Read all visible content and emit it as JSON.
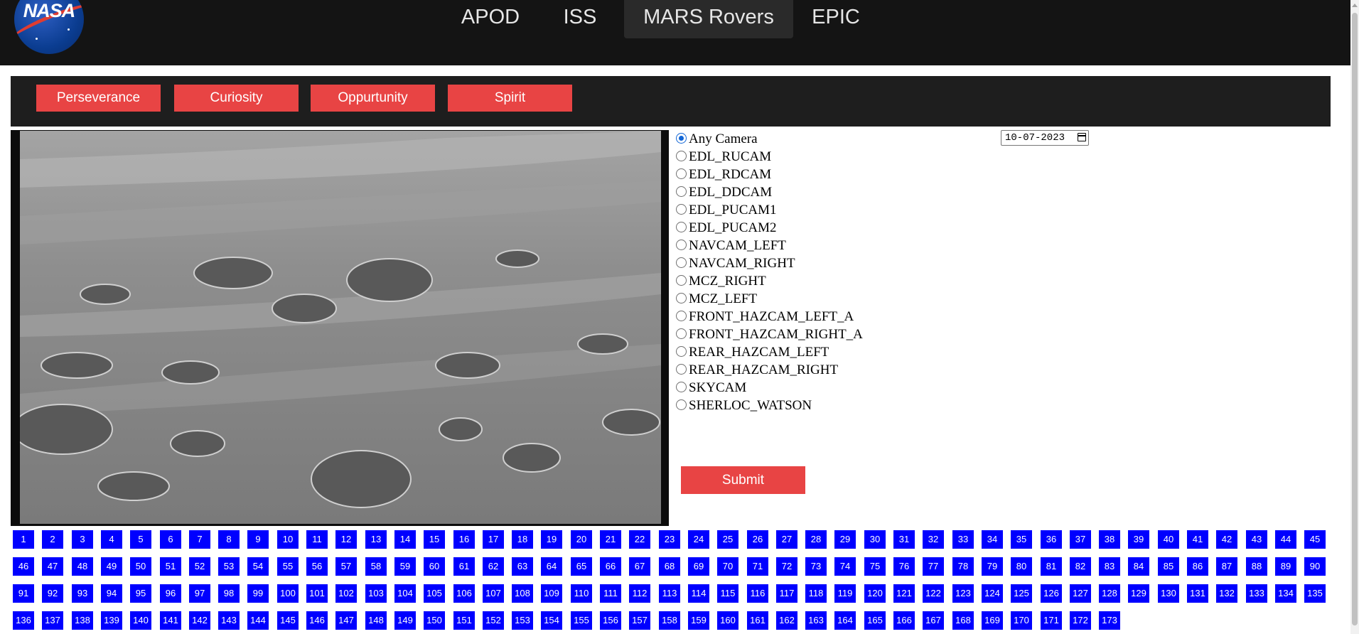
{
  "nav": {
    "logo_text": "NASA",
    "items": [
      {
        "label": "APOD",
        "active": false
      },
      {
        "label": "ISS",
        "active": false
      },
      {
        "label": "MARS Rovers",
        "active": true
      },
      {
        "label": "EPIC",
        "active": false
      }
    ]
  },
  "rovers": {
    "buttons": [
      "Perseverance",
      "Curiosity",
      "Oppurtunity",
      "Spirit"
    ],
    "accent": "#e84444"
  },
  "cameras": {
    "selected": "Any Camera",
    "options": [
      "Any Camera",
      "EDL_RUCAM",
      "EDL_RDCAM",
      "EDL_DDCAM",
      "EDL_PUCAM1",
      "EDL_PUCAM2",
      "NAVCAM_LEFT",
      "NAVCAM_RIGHT",
      "MCZ_RIGHT",
      "MCZ_LEFT",
      "FRONT_HAZCAM_LEFT_A",
      "FRONT_HAZCAM_RIGHT_A",
      "REAR_HAZCAM_LEFT",
      "REAR_HAZCAM_RIGHT",
      "SKYCAM",
      "SHERLOC_WATSON"
    ]
  },
  "date": {
    "value": "10-07-2023",
    "icon": "calendar-icon"
  },
  "submit_label": "Submit",
  "pagination": {
    "first": 1,
    "last": 173,
    "color": "#0000ff"
  }
}
